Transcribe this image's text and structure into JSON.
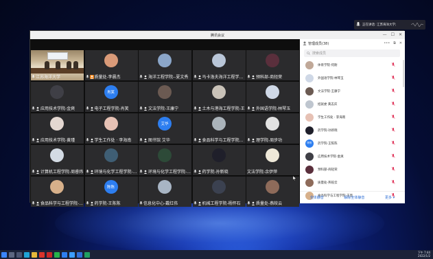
{
  "window": {
    "title": "腾讯会议"
  },
  "speaking_indicator": {
    "text": "正在讲话: 江苏海洋大学;"
  },
  "colors": {
    "wallpaper": "#0a1c6b",
    "accent_blue": "#2f6fd6",
    "mic_red": "#e0355a",
    "panel_bg": "#ffffff",
    "grid_bg": "#2b2b2d"
  },
  "participants": [
    {
      "name": "江苏海洋大学",
      "kind": "video"
    },
    {
      "name": "质量处-李晨杰",
      "avatar_text": "",
      "avatar_color": "#d99a78",
      "star": true
    },
    {
      "name": "海洋工程学院--夏文秀",
      "avatar_text": "",
      "avatar_color": "#8ba6c9"
    },
    {
      "name": "马卡洛夫海洋工程学...",
      "avatar_text": "",
      "avatar_color": "#b9c6d8"
    },
    {
      "name": "预科部-商轻荣",
      "avatar_text": "",
      "avatar_color": "#5a2f3c"
    },
    {
      "name": "应用技术学院-金爽",
      "avatar_text": "",
      "avatar_color": "#3f3f46"
    },
    {
      "name": "电子工程学院-肖笑",
      "avatar_text": "肖笑",
      "avatar_color": "#2d7ef0"
    },
    {
      "name": "文法学院-王康宁",
      "avatar_text": "",
      "avatar_color": "#6b5a52"
    },
    {
      "name": "土木与港海工程学院-王...",
      "avatar_text": "",
      "avatar_color": "#c9c2b8"
    },
    {
      "name": "外国语学院-林琴玉",
      "avatar_text": "",
      "avatar_color": "#cfd8e6"
    },
    {
      "name": "应用技术学院-黄瑾",
      "avatar_text": "",
      "avatar_color": "#e3d7d1"
    },
    {
      "name": "学生工作处 · 李海南",
      "avatar_text": "",
      "avatar_color": "#e6c1b4"
    },
    {
      "name": "图书馆 艾华",
      "avatar_text": "艾华",
      "avatar_color": "#2d7ef0"
    },
    {
      "name": "食品科学与工程学院...",
      "avatar_text": "",
      "avatar_color": "#aab3ba"
    },
    {
      "name": "理学院-周步功",
      "avatar_text": "",
      "avatar_color": "#e2e2e2"
    },
    {
      "name": "计算机工程学院-周睿炜",
      "avatar_text": "",
      "avatar_color": "#d3dbe4"
    },
    {
      "name": "环境与化学工程学院-...",
      "avatar_text": "",
      "avatar_color": "#3f5e74"
    },
    {
      "name": "环境与化学工程学院-...",
      "avatar_text": "",
      "avatar_color": "#2d4a38"
    },
    {
      "name": "药学院-孙新晓",
      "avatar_text": "",
      "avatar_color": "#1f1f2a"
    },
    {
      "name": "文法学院-余伊萍",
      "avatar_text": "",
      "avatar_color": "#eee8d8",
      "no_icons": true
    },
    {
      "name": "食品科学与工程学院-...",
      "avatar_text": "",
      "avatar_color": "#d7b08a"
    },
    {
      "name": "药学院-王陈陈",
      "avatar_text": "陈陈",
      "avatar_color": "#2d7ef0"
    },
    {
      "name": "信息化中心-戴红伟",
      "avatar_text": "",
      "avatar_color": "#a8b5c4",
      "no_star": true
    },
    {
      "name": "机械工程学院-杨怀石",
      "avatar_text": "",
      "avatar_color": "#3b4150"
    },
    {
      "name": "质量处-燕皎云",
      "avatar_text": "",
      "avatar_color": "#8e6b5a"
    }
  ],
  "member_panel": {
    "title": "管理成员(38)",
    "search_placeholder": "搜索成员",
    "members": [
      {
        "name": "体育学院-何耐",
        "avatar_color": "#c0a898"
      },
      {
        "name": "外国语学院-林琴玉",
        "avatar_color": "#cfd8e6"
      },
      {
        "name": "文法学院-王康宁",
        "avatar_color": "#6b5a52"
      },
      {
        "name": "招就委 黄志庆",
        "avatar_color": "#bfc6cf"
      },
      {
        "name": "学生工作处 · 李海南",
        "avatar_color": "#e6c1b4"
      },
      {
        "name": "药学院-孙新晓",
        "avatar_color": "#1f1f2a"
      },
      {
        "name": "药学院-王陈陈",
        "avatar_color": "#2d7ef0",
        "avatar_text": "陈陈"
      },
      {
        "name": "应用技术学院-金爽",
        "avatar_color": "#3f3f46"
      },
      {
        "name": "预科部-商轻荣",
        "avatar_color": "#5a2f3c"
      },
      {
        "name": "质量处-燕皎云",
        "avatar_color": "#8e6b5a"
      },
      {
        "name": "食品科学与工程学院-王黑",
        "avatar_color": "#d7b08a"
      }
    ],
    "footer": {
      "mute_all": "全体静音",
      "unmute_all": "解除全体静音",
      "more": "更多 ▾"
    }
  },
  "taskbar": {
    "time": "下午 7:44",
    "date": "2022/1/2"
  }
}
